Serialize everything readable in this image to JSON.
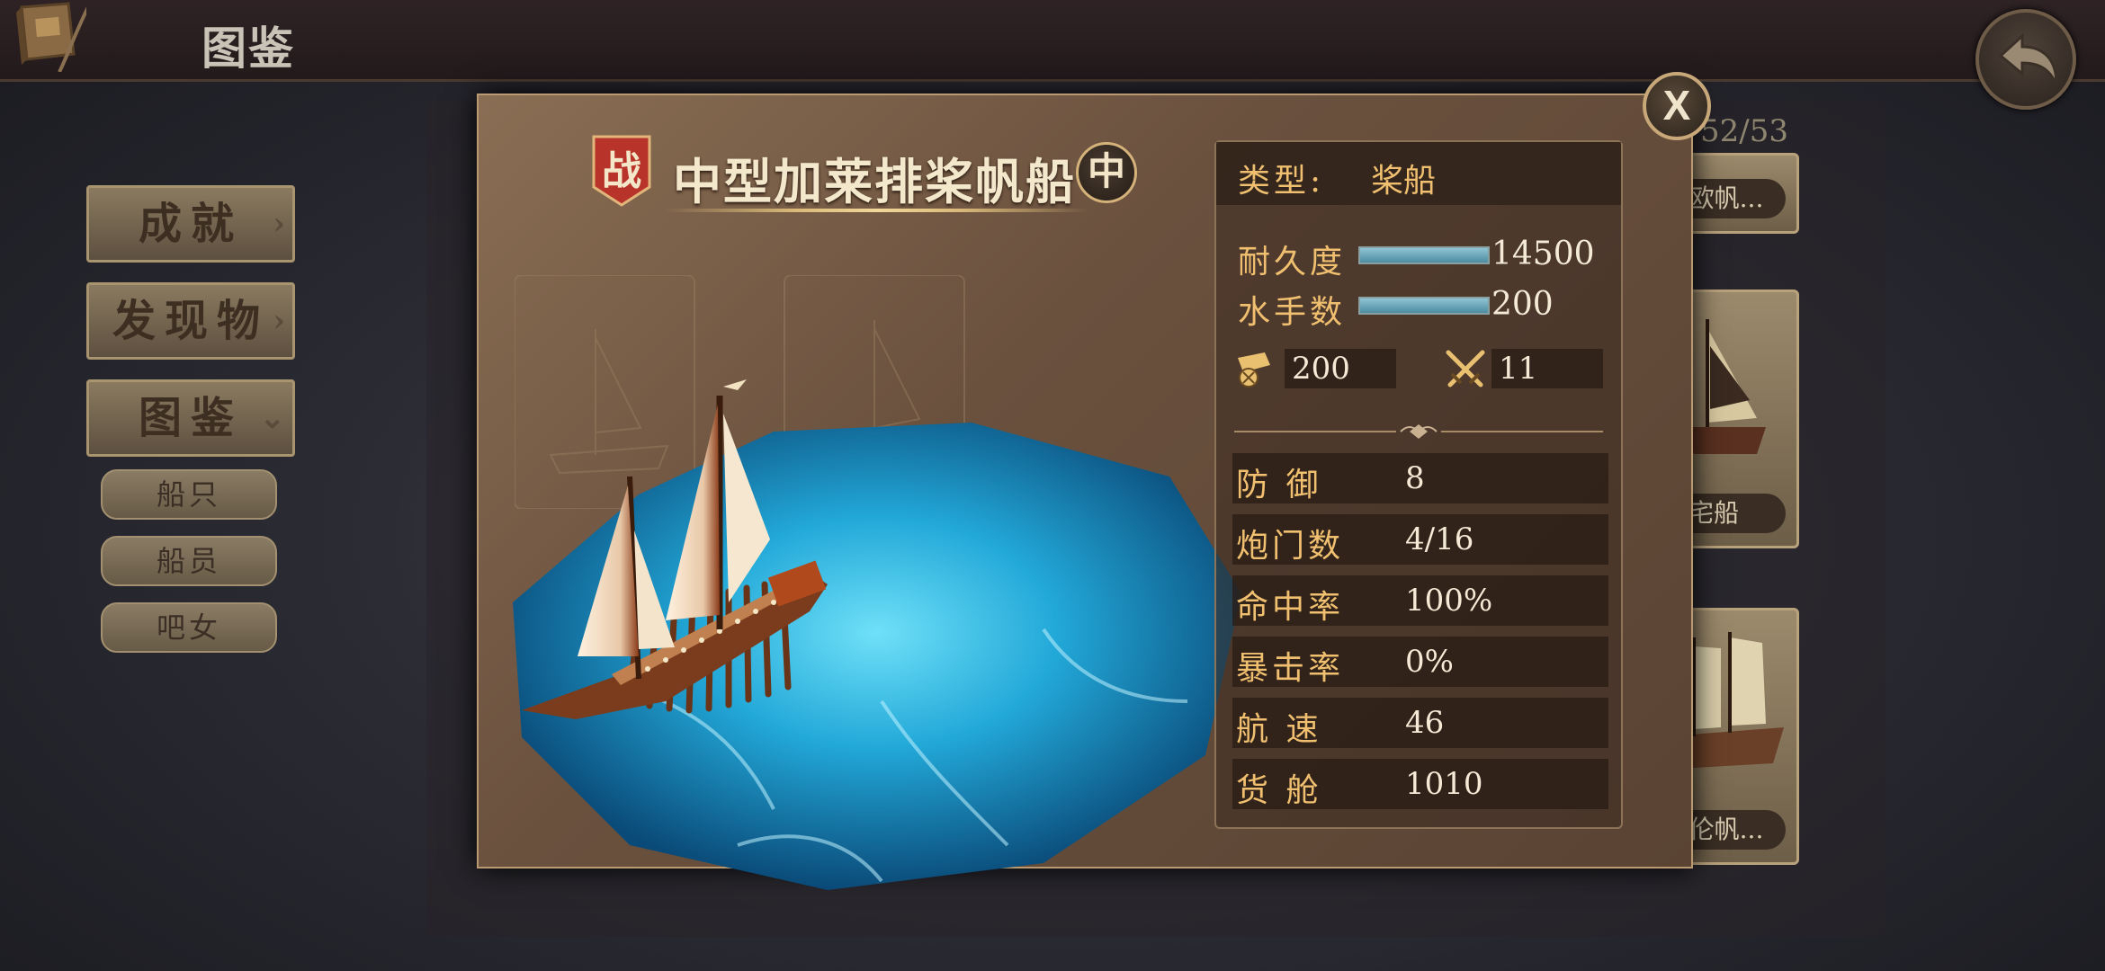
{
  "header": {
    "title": "图鉴"
  },
  "list": {
    "count": "52/53",
    "visible_cards": [
      {
        "label": "北欧帆..."
      },
      {
        "label": "宅船"
      },
      {
        "label": "盖伦帆..."
      }
    ]
  },
  "menu": {
    "items": [
      {
        "label": "成就"
      },
      {
        "label": "发现物"
      },
      {
        "label": "图鉴"
      }
    ],
    "sub_items": [
      {
        "label": "船只"
      },
      {
        "label": "船员"
      },
      {
        "label": "吧女"
      }
    ]
  },
  "ship": {
    "war_badge": "战",
    "name": "中型加莱排桨帆船",
    "size_badge": "中",
    "type_label": "类型:",
    "type_value": "桨船",
    "durability": {
      "label": "耐久度",
      "value": "14500",
      "fill": 1.0
    },
    "crew": {
      "label": "水手数",
      "value": "200",
      "fill": 1.0
    },
    "cannon_value": "200",
    "melee_value": "11",
    "stats": [
      {
        "label": "防 御",
        "value": "8"
      },
      {
        "label": "炮门数",
        "value": "4/16"
      },
      {
        "label": "命中率",
        "value": "100%"
      },
      {
        "label": "暴击率",
        "value": "0%"
      },
      {
        "label": "航 速",
        "value": "46"
      },
      {
        "label": "货 舱",
        "value": "1010"
      }
    ]
  },
  "icons": {
    "book": "book-icon",
    "back": "back-arrow-icon",
    "close": "close-icon",
    "cannon": "cannon-icon",
    "melee": "crossed-swords-icon"
  },
  "colors": {
    "accent_gold": "#f0c070",
    "war_badge_red": "#b8342a",
    "sea_cyan": "#2fb8e0"
  }
}
